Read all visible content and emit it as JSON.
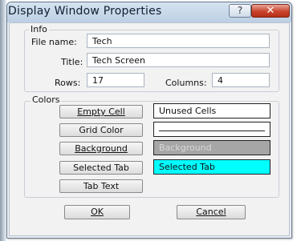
{
  "window": {
    "title": "Display Window Properties",
    "help_glyph": "?",
    "close_glyph": "✕"
  },
  "info": {
    "legend": "Info",
    "file_name_label": "File name:",
    "file_name_value": "Tech",
    "title_label": "Title:",
    "title_value": "Tech Screen",
    "rows_label": "Rows:",
    "rows_value": "17",
    "columns_label": "Columns:",
    "columns_value": "4"
  },
  "colors": {
    "legend": "Colors",
    "empty_cell": {
      "button": "Empty Cell",
      "swatch_text": "Unused Cells",
      "swatch_color": "#ffffff"
    },
    "grid_color": {
      "button": "Grid Color",
      "swatch_text": "",
      "swatch_color": "#ffffff"
    },
    "background": {
      "button": "Background",
      "swatch_text": "Background",
      "swatch_color": "#a6a6a6"
    },
    "selected_tab": {
      "button": "Selected Tab",
      "swatch_text": "Selected Tab",
      "swatch_color": "#00ffff"
    },
    "tab_text": {
      "button": "Tab Text"
    }
  },
  "footer": {
    "ok_label": "OK",
    "cancel_label": "Cancel"
  }
}
